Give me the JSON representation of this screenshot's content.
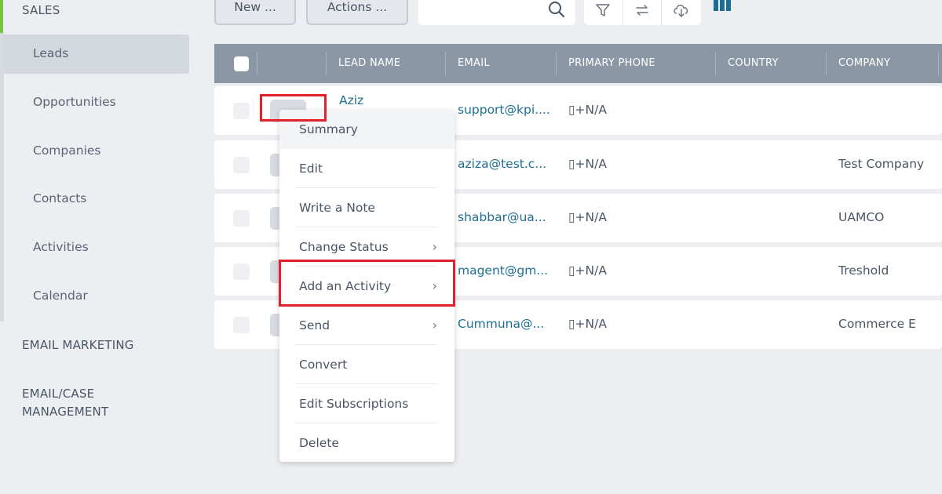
{
  "sidebar": {
    "section_sales": "SALES",
    "items": [
      {
        "label": "Leads",
        "active": true
      },
      {
        "label": "Opportunities"
      },
      {
        "label": "Companies"
      },
      {
        "label": "Contacts"
      },
      {
        "label": "Activities"
      },
      {
        "label": "Calendar"
      }
    ],
    "section_email_marketing": "EMAIL MARKETING",
    "section_case_line1": "EMAIL/CASE",
    "section_case_line2": "MANAGEMENT",
    "accent_color": "#7cc242"
  },
  "toolbar": {
    "new_label": "New ...",
    "actions_label": "Actions ...",
    "search_placeholder": "",
    "icons": [
      "search-icon",
      "filter-icon",
      "refresh-icon",
      "cloud-download-icon",
      "columns-icon"
    ]
  },
  "table": {
    "columns": [
      "LEAD NAME",
      "EMAIL",
      "PRIMARY PHONE",
      "COUNTRY",
      "COMPANY"
    ],
    "rows": [
      {
        "lead_name": "Aziz",
        "email": "support@kpi....",
        "phone": "▯+N/A",
        "country": "",
        "company": ""
      },
      {
        "lead_name": "",
        "email": "aziza@test.c...",
        "phone": "▯+N/A",
        "country": "",
        "company": "Test Company"
      },
      {
        "lead_name": "",
        "email": "shabbar@ua...",
        "phone": "▯+N/A",
        "country": "",
        "company": "UAMCO"
      },
      {
        "lead_name": "",
        "email": "magent@gm...",
        "phone": "▯+N/A",
        "country": "",
        "company": "Treshold"
      },
      {
        "lead_name": "",
        "email": "Cummuna@...",
        "phone": "▯+N/A",
        "country": "",
        "company": "Commerce E"
      }
    ]
  },
  "context_menu": {
    "items": [
      {
        "label": "Summary",
        "submenu": false
      },
      {
        "label": "Edit",
        "submenu": false
      },
      {
        "label": "Write a Note",
        "submenu": false
      },
      {
        "label": "Change Status",
        "submenu": true
      },
      {
        "label": "Add an Activity",
        "submenu": true
      },
      {
        "label": "Send",
        "submenu": true
      },
      {
        "label": "Convert",
        "submenu": false
      },
      {
        "label": "Edit Subscriptions",
        "submenu": false
      },
      {
        "label": "Delete",
        "submenu": false
      }
    ],
    "chevron": "›"
  },
  "colors": {
    "header_bg": "#8c97a5",
    "link": "#1d6f91",
    "highlight": "#e0202b",
    "columns_icon": "#1d6f91"
  }
}
